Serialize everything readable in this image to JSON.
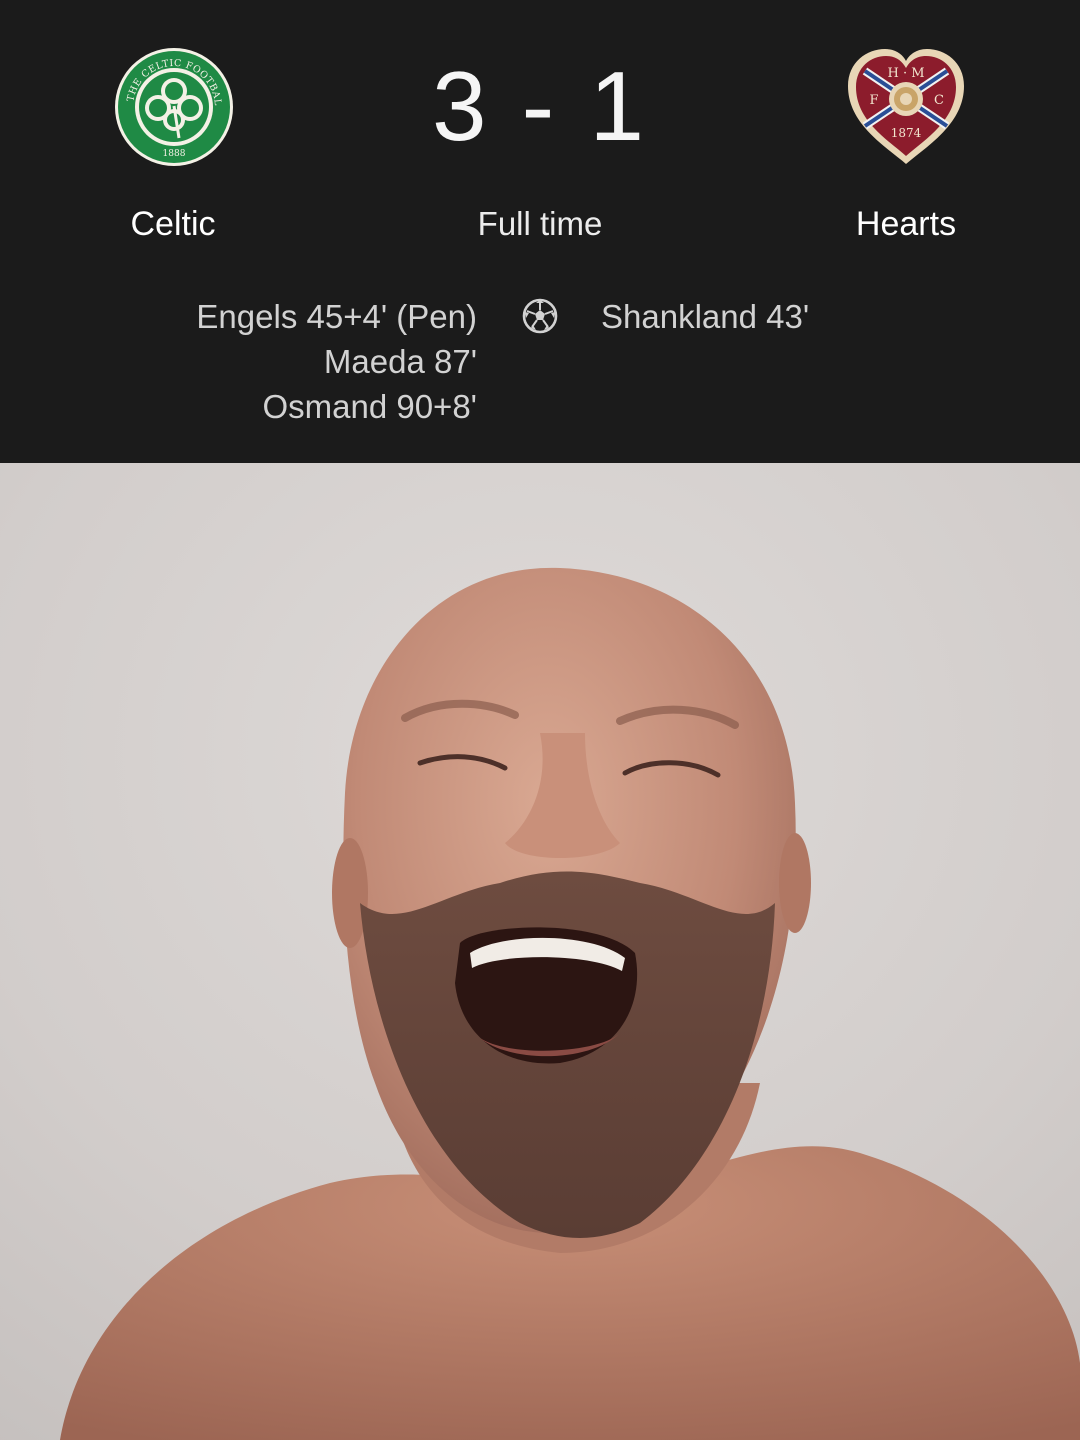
{
  "match": {
    "home_team": {
      "name": "Celtic",
      "crest_text": "THE CELTIC FOOTBALL CLUB",
      "crest_year": "1888",
      "crest_icon": "shamrock-crest"
    },
    "away_team": {
      "name": "Hearts",
      "crest_letters": "H · M F C",
      "crest_year": "1874",
      "crest_icon": "heart-crest"
    },
    "home_score": "3",
    "separator": "-",
    "away_score": "1",
    "score_display": "3 - 1",
    "status": "Full time",
    "goal_icon": "soccer-ball-icon",
    "home_scorers": [
      "Engels 45+4' (Pen)",
      "Maeda 87'",
      "Osmand 90+8'"
    ],
    "away_scorers": [
      "Shankland 43'"
    ]
  },
  "colors": {
    "scoreboard_bg": "#1b1b1b",
    "celtic_green": "#1f8a45",
    "hearts_maroon": "#8c1c2c",
    "hearts_blue": "#2a4e96",
    "photo_wall": "#d4cfcd",
    "skin": "#c48e7a"
  },
  "media": {
    "description_icon": "reaction-photo"
  }
}
